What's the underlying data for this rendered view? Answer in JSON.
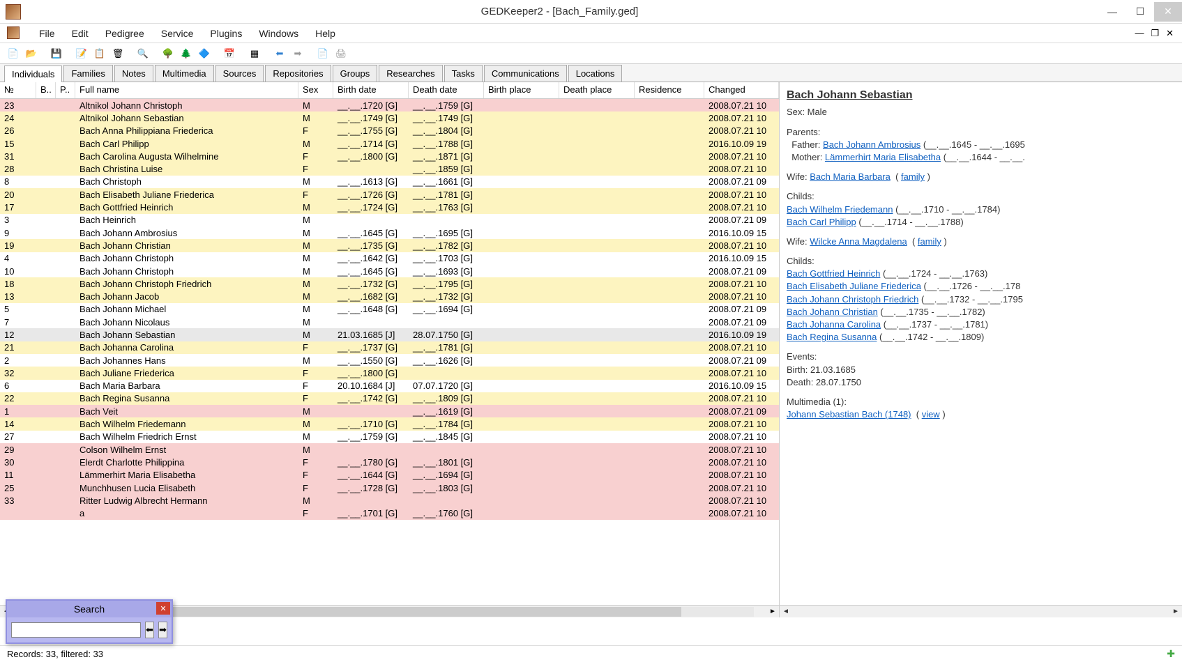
{
  "window": {
    "title": "GEDKeeper2 - [Bach_Family.ged]"
  },
  "menus": [
    "File",
    "Edit",
    "Pedigree",
    "Service",
    "Plugins",
    "Windows",
    "Help"
  ],
  "tabs": [
    "Individuals",
    "Families",
    "Notes",
    "Multimedia",
    "Sources",
    "Repositories",
    "Groups",
    "Researches",
    "Tasks",
    "Communications",
    "Locations"
  ],
  "active_tab": 0,
  "columns": [
    "№",
    "B..",
    "P..",
    "Full name",
    "Sex",
    "Birth date",
    "Death date",
    "Birth place",
    "Death place",
    "Residence",
    "Changed"
  ],
  "rows": [
    {
      "no": "23",
      "name": "Altnikol Johann Christoph",
      "sex": "M",
      "birth": "__.__.1720 [G]",
      "death": "__.__.1759 [G]",
      "chg": "2008.07.21 10",
      "cls": "row-pink"
    },
    {
      "no": "24",
      "name": "Altnikol Johann Sebastian",
      "sex": "M",
      "birth": "__.__.1749 [G]",
      "death": "__.__.1749 [G]",
      "chg": "2008.07.21 10",
      "cls": "row-yellow"
    },
    {
      "no": "26",
      "name": "Bach Anna Philippiana Friederica",
      "sex": "F",
      "birth": "__.__.1755 [G]",
      "death": "__.__.1804 [G]",
      "chg": "2008.07.21 10",
      "cls": "row-yellow"
    },
    {
      "no": "15",
      "name": "Bach Carl Philipp",
      "sex": "M",
      "birth": "__.__.1714 [G]",
      "death": "__.__.1788 [G]",
      "chg": "2016.10.09 19",
      "cls": "row-yellow"
    },
    {
      "no": "31",
      "name": "Bach Carolina Augusta Wilhelmine",
      "sex": "F",
      "birth": "__.__.1800 [G]",
      "death": "__.__.1871 [G]",
      "chg": "2008.07.21 10",
      "cls": "row-yellow"
    },
    {
      "no": "28",
      "name": "Bach Christina Luise",
      "sex": "F",
      "birth": "",
      "death": "__.__.1859 [G]",
      "chg": "2008.07.21 10",
      "cls": "row-yellow"
    },
    {
      "no": "8",
      "name": "Bach Christoph",
      "sex": "M",
      "birth": "__.__.1613 [G]",
      "death": "__.__.1661 [G]",
      "chg": "2008.07.21 09",
      "cls": ""
    },
    {
      "no": "20",
      "name": "Bach Elisabeth Juliane Friederica",
      "sex": "F",
      "birth": "__.__.1726 [G]",
      "death": "__.__.1781 [G]",
      "chg": "2008.07.21 10",
      "cls": "row-yellow"
    },
    {
      "no": "17",
      "name": "Bach Gottfried Heinrich",
      "sex": "M",
      "birth": "__.__.1724 [G]",
      "death": "__.__.1763 [G]",
      "chg": "2008.07.21 10",
      "cls": "row-yellow"
    },
    {
      "no": "3",
      "name": "Bach Heinrich",
      "sex": "M",
      "birth": "",
      "death": "",
      "chg": "2008.07.21 09",
      "cls": ""
    },
    {
      "no": "9",
      "name": "Bach Johann Ambrosius",
      "sex": "M",
      "birth": "__.__.1645 [G]",
      "death": "__.__.1695 [G]",
      "chg": "2016.10.09 15",
      "cls": ""
    },
    {
      "no": "19",
      "name": "Bach Johann Christian",
      "sex": "M",
      "birth": "__.__.1735 [G]",
      "death": "__.__.1782 [G]",
      "chg": "2008.07.21 10",
      "cls": "row-yellow"
    },
    {
      "no": "4",
      "name": "Bach Johann Christoph",
      "sex": "M",
      "birth": "__.__.1642 [G]",
      "death": "__.__.1703 [G]",
      "chg": "2016.10.09 15",
      "cls": ""
    },
    {
      "no": "10",
      "name": "Bach Johann Christoph",
      "sex": "M",
      "birth": "__.__.1645 [G]",
      "death": "__.__.1693 [G]",
      "chg": "2008.07.21 09",
      "cls": ""
    },
    {
      "no": "18",
      "name": "Bach Johann Christoph Friedrich",
      "sex": "M",
      "birth": "__.__.1732 [G]",
      "death": "__.__.1795 [G]",
      "chg": "2008.07.21 10",
      "cls": "row-yellow"
    },
    {
      "no": "13",
      "name": "Bach Johann Jacob",
      "sex": "M",
      "birth": "__.__.1682 [G]",
      "death": "__.__.1732 [G]",
      "chg": "2008.07.21 10",
      "cls": "row-yellow"
    },
    {
      "no": "5",
      "name": "Bach Johann Michael",
      "sex": "M",
      "birth": "__.__.1648 [G]",
      "death": "__.__.1694 [G]",
      "chg": "2008.07.21 09",
      "cls": ""
    },
    {
      "no": "7",
      "name": "Bach Johann Nicolaus",
      "sex": "M",
      "birth": "",
      "death": "",
      "chg": "2008.07.21 09",
      "cls": ""
    },
    {
      "no": "12",
      "name": "Bach Johann Sebastian",
      "sex": "M",
      "birth": "21.03.1685 [J]",
      "death": "28.07.1750 [G]",
      "chg": "2016.10.09 19",
      "cls": "row-sel"
    },
    {
      "no": "21",
      "name": "Bach Johanna Carolina",
      "sex": "F",
      "birth": "__.__.1737 [G]",
      "death": "__.__.1781 [G]",
      "chg": "2008.07.21 10",
      "cls": "row-yellow"
    },
    {
      "no": "2",
      "name": "Bach Johannes Hans",
      "sex": "M",
      "birth": "__.__.1550 [G]",
      "death": "__.__.1626 [G]",
      "chg": "2008.07.21 09",
      "cls": ""
    },
    {
      "no": "32",
      "name": "Bach Juliane Friederica",
      "sex": "F",
      "birth": "__.__.1800 [G]",
      "death": "",
      "chg": "2008.07.21 10",
      "cls": "row-yellow"
    },
    {
      "no": "6",
      "name": "Bach Maria Barbara",
      "sex": "F",
      "birth": "20.10.1684 [J]",
      "death": "07.07.1720 [G]",
      "chg": "2016.10.09 15",
      "cls": ""
    },
    {
      "no": "22",
      "name": "Bach Regina Susanna",
      "sex": "F",
      "birth": "__.__.1742 [G]",
      "death": "__.__.1809 [G]",
      "chg": "2008.07.21 10",
      "cls": "row-yellow"
    },
    {
      "no": "1",
      "name": "Bach Veit",
      "sex": "M",
      "birth": "",
      "death": "__.__.1619 [G]",
      "chg": "2008.07.21 09",
      "cls": "row-pink"
    },
    {
      "no": "14",
      "name": "Bach Wilhelm Friedemann",
      "sex": "M",
      "birth": "__.__.1710 [G]",
      "death": "__.__.1784 [G]",
      "chg": "2008.07.21 10",
      "cls": "row-yellow"
    },
    {
      "no": "27",
      "name": "Bach Wilhelm Friedrich Ernst",
      "sex": "M",
      "birth": "__.__.1759 [G]",
      "death": "__.__.1845 [G]",
      "chg": "2008.07.21 10",
      "cls": ""
    },
    {
      "no": "29",
      "name": "Colson Wilhelm Ernst",
      "sex": "M",
      "birth": "",
      "death": "",
      "chg": "2008.07.21 10",
      "cls": "row-pink"
    },
    {
      "no": "30",
      "name": "Elerdt Charlotte Philippina",
      "sex": "F",
      "birth": "__.__.1780 [G]",
      "death": "__.__.1801 [G]",
      "chg": "2008.07.21 10",
      "cls": "row-pink"
    },
    {
      "no": "11",
      "name": "Lämmerhirt Maria Elisabetha",
      "sex": "F",
      "birth": "__.__.1644 [G]",
      "death": "__.__.1694 [G]",
      "chg": "2008.07.21 10",
      "cls": "row-pink"
    },
    {
      "no": "25",
      "name": "Munchhusen Lucia Elisabeth",
      "sex": "F",
      "birth": "__.__.1728 [G]",
      "death": "__.__.1803 [G]",
      "chg": "2008.07.21 10",
      "cls": "row-pink"
    },
    {
      "no": "33",
      "name": "Ritter Ludwig Albrecht Hermann",
      "sex": "M",
      "birth": "",
      "death": "",
      "chg": "2008.07.21 10",
      "cls": "row-pink"
    },
    {
      "no": "",
      "name": "a",
      "sex": "F",
      "birth": "__.__.1701 [G]",
      "death": "__.__.1760 [G]",
      "chg": "2008.07.21 10",
      "cls": "row-pink"
    }
  ],
  "detail": {
    "name": "Bach Johann Sebastian",
    "sex": "Sex: Male",
    "parents_label": "Parents:",
    "father_label": "Father: ",
    "father_link": "Bach Johann Ambrosius",
    "father_dates": "  (__.__.1645 - __.__.1695",
    "mother_label": "Mother: ",
    "mother_link": "Lämmerhirt Maria Elisabetha",
    "mother_dates": "  (__.__.1644 - __.__.",
    "wife1_label": "Wife: ",
    "wife1_link": "Bach Maria Barbara",
    "family_label": "family",
    "childs_label": "Childs:",
    "child1": "Bach Wilhelm Friedemann",
    "child1_d": "  (__.__.1710 - __.__.1784)",
    "child2": "Bach Carl Philipp",
    "child2_d": "  (__.__.1714 - __.__.1788)",
    "wife2_label": "Wife: ",
    "wife2_link": "Wilcke Anna Magdalena",
    "child3": "Bach Gottfried Heinrich",
    "child3_d": "  (__.__.1724 - __.__.1763)",
    "child4": "Bach Elisabeth Juliane Friederica",
    "child4_d": "  (__.__.1726 - __.__.178",
    "child5": "Bach Johann Christoph Friedrich",
    "child5_d": "  (__.__.1732 - __.__.1795",
    "child6": "Bach Johann Christian",
    "child6_d": "  (__.__.1735 - __.__.1782)",
    "child7": "Bach Johanna Carolina",
    "child7_d": "  (__.__.1737 - __.__.1781)",
    "child8": "Bach Regina Susanna",
    "child8_d": "  (__.__.1742 - __.__.1809)",
    "events_label": "Events:",
    "birth_event": "Birth: 21.03.1685",
    "death_event": "Death: 28.07.1750",
    "mm_label": "Multimedia (1):",
    "mm_link": "Johann Sebastian Bach (1748)",
    "view_label": "view"
  },
  "status": "Records: 33, filtered: 33",
  "search": {
    "title": "Search",
    "value": ""
  }
}
